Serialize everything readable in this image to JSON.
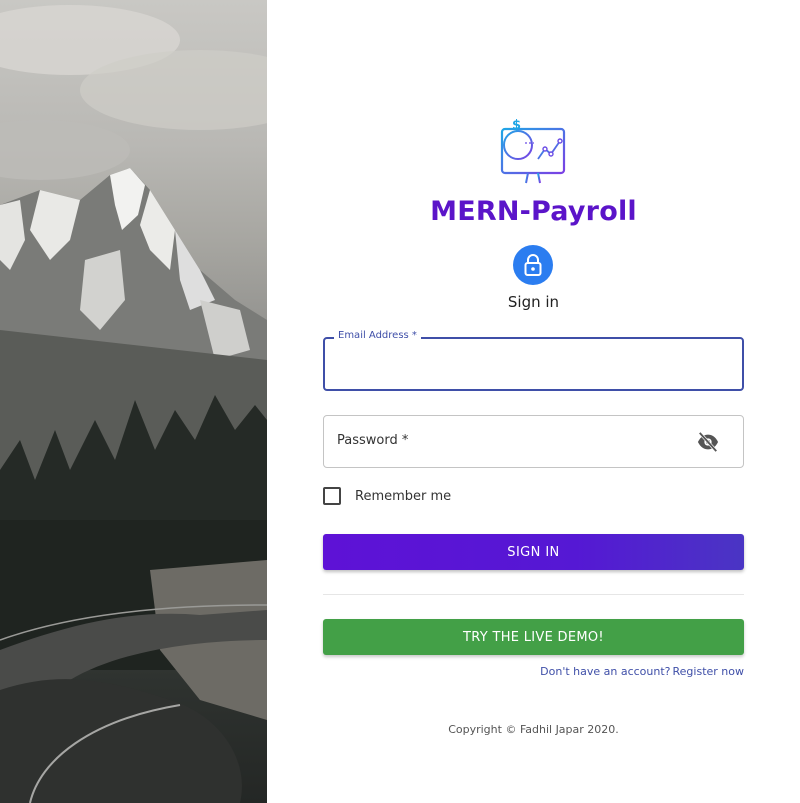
{
  "app": {
    "title": "MERN-Payroll"
  },
  "form": {
    "heading": "Sign in",
    "email": {
      "label": "Email Address *",
      "value": ""
    },
    "password": {
      "label": "Password *"
    },
    "remember_label": "Remember me",
    "signin_label": "SIGN IN",
    "demo_label": "TRY THE LIVE DEMO!",
    "no_account_text": "Don't have an account?",
    "register_link": "Register now"
  },
  "footer": {
    "copyright": "Copyright © Fadhil Japar 2020."
  },
  "icons": {
    "logo": "payroll-monitor-icon",
    "lock": "lock-icon",
    "password_toggle": "eye-off-icon"
  },
  "colors": {
    "brand": "#5b14c9",
    "signin_button": "#5e12d6",
    "demo_button": "#43a047",
    "link": "#3f4fa8",
    "lock_avatar": "#2b7df0"
  }
}
